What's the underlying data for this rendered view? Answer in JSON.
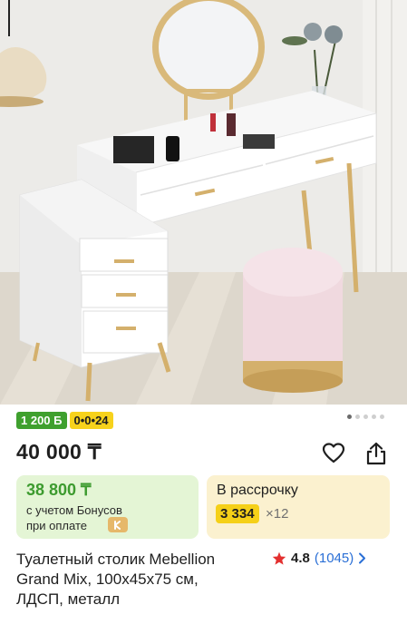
{
  "badges": {
    "bonus": "1 200 Б",
    "installment": "0•0•24"
  },
  "gallery": {
    "total": 5,
    "active": 0
  },
  "product": {
    "price": "40 000 ₸",
    "title_line1": "Туалетный столик Mebellion",
    "title_line2": "Grand Mix, 100x45x75 см,",
    "title_line3": "ЛДСП, металл"
  },
  "bonus_card": {
    "price": "38 800 ₸",
    "line1": "с учетом Бонусов",
    "line2": "при оплате"
  },
  "installment_card": {
    "label": "В рассрочку",
    "amount": "3 334",
    "times": "×12"
  },
  "rating": {
    "value": "4.8",
    "count": "(1045)"
  },
  "icons": {
    "favorite": "heart-icon",
    "share": "share-icon",
    "rating_star": "star-icon",
    "chevron": "chevron-right-icon",
    "kaspi_bonus": "bonus-logo-icon"
  },
  "colors": {
    "bonus_green": "#3fa02e",
    "installment_yellow": "#f7d21c",
    "star_red": "#e3302f",
    "link_blue": "#2a6fd6"
  }
}
